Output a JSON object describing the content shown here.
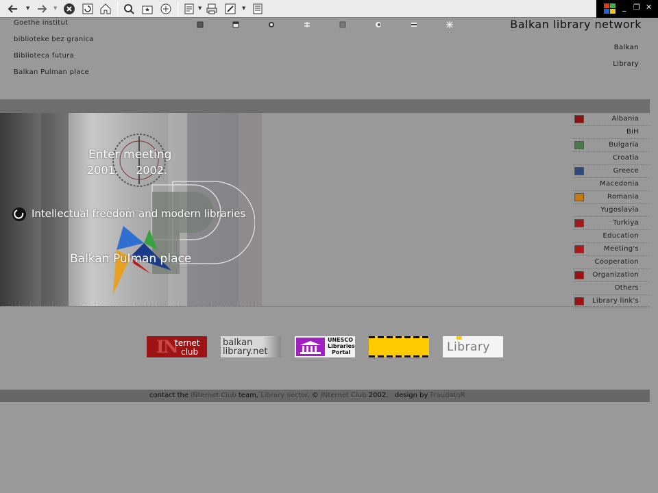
{
  "browser": {
    "toolbar_icons": [
      "back-icon",
      "forward-icon",
      "stop-icon",
      "refresh-icon",
      "home-icon",
      "search-icon",
      "favorites-icon",
      "media-icon",
      "history-icon",
      "mail-icon",
      "print-icon",
      "edit-icon",
      "discuss-icon"
    ]
  },
  "top_links": [
    {
      "label": "Goethe institut"
    },
    {
      "label": "biblioteke bez granica"
    },
    {
      "label": "Biblioteca futura"
    },
    {
      "label": "Balkan Pulman place"
    }
  ],
  "header": {
    "title": "Balkan library network",
    "subtitle_a": "Balkan",
    "subtitle_b": "Library"
  },
  "banner": {
    "enter_line1": "Enter meeting",
    "enter_line2": "2001.     2002.",
    "intellectual": "Intellectual freedom and modern libraries",
    "pulman": "Balkan Pulman place"
  },
  "side_nav": [
    {
      "label": "Albania",
      "icon": "red-square-icon",
      "color": "#8b1111"
    },
    {
      "label": "BiH",
      "icon": "",
      "color": ""
    },
    {
      "label": "Bulgaria",
      "icon": "flag-icon",
      "color": "#4a7a4a"
    },
    {
      "label": "Croatia",
      "icon": "",
      "color": ""
    },
    {
      "label": "Greece",
      "icon": "arrow-icon",
      "color": "#2c4a80"
    },
    {
      "label": "Macedonia",
      "icon": "",
      "color": ""
    },
    {
      "label": "Romania",
      "icon": "arrow-icon",
      "color": "#c47a10"
    },
    {
      "label": "Yugoslavia",
      "icon": "",
      "color": ""
    },
    {
      "label": "Turkiya",
      "icon": "x-icon",
      "color": "#a01818"
    },
    {
      "label": "Education",
      "icon": "",
      "color": ""
    },
    {
      "label": "Meeting's",
      "icon": "m-icon",
      "color": "#b01818"
    },
    {
      "label": "Cooperation",
      "icon": "",
      "color": ""
    },
    {
      "label": "Organization",
      "icon": "dot-icon",
      "color": "#a01010"
    },
    {
      "label": "Others",
      "icon": "",
      "color": ""
    },
    {
      "label": "Library link's",
      "icon": "dot-icon",
      "color": "#a01010"
    }
  ],
  "partners": {
    "internet_club_big": "IN",
    "internet_club_top": "ternet",
    "internet_club_bottom": "club",
    "balkan_top": "balkan",
    "balkan_bottom": "library.net",
    "unesco_1": "UNESCO",
    "unesco_2": "Libraries",
    "unesco_3": "Portal",
    "library_label": "Library"
  },
  "footer": {
    "p1": "contact the ",
    "l1": "INternet Club",
    "p2": " team, ",
    "l2": "Library sector",
    "p3": ". © ",
    "l3": "INternet Club",
    "p4": " 2002.   design by ",
    "l4": "FraudatoR"
  }
}
